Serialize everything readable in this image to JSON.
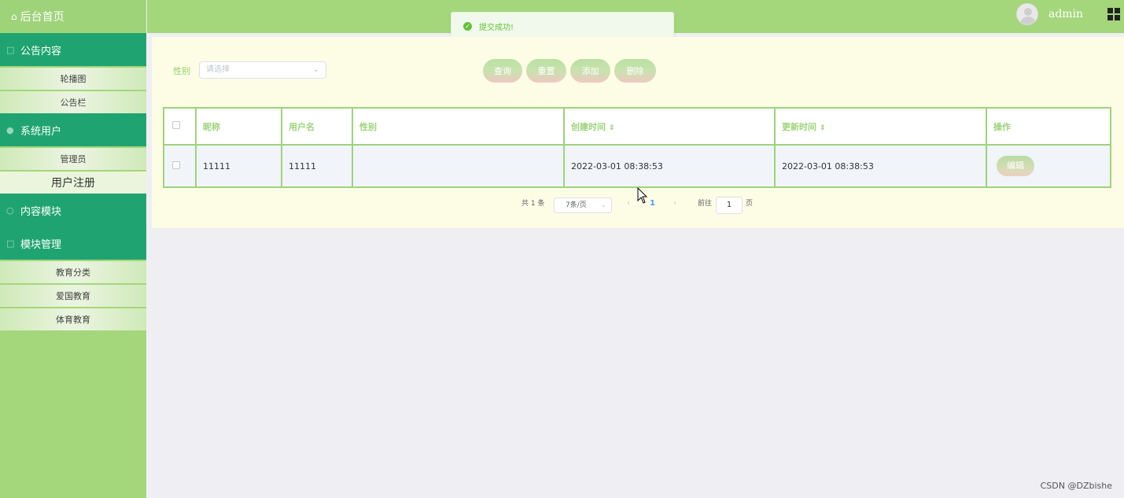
{
  "sidebar": {
    "home": "后台首页",
    "groups": [
      {
        "label": "公告内容",
        "items": [
          "轮播图",
          "公告栏"
        ]
      },
      {
        "label": "系统用户",
        "items": [
          "管理员",
          "用户注册"
        ]
      },
      {
        "label": "内容模块",
        "items": []
      },
      {
        "label": "模块管理",
        "items": [
          "教育分类",
          "爱国教育",
          "体育教育"
        ]
      }
    ]
  },
  "header": {
    "username": "admin"
  },
  "toast": {
    "message": "提交成功!"
  },
  "filter": {
    "label": "性别",
    "placeholder": "请选择"
  },
  "actions": {
    "query": "查询",
    "reset": "重置",
    "add": "添加",
    "delete": "删除"
  },
  "table": {
    "headers": [
      "昵称",
      "用户名",
      "性别",
      "创建时间",
      "更新时间",
      "操作"
    ],
    "rows": [
      {
        "nickname": "11111",
        "username": "11111",
        "gender": "",
        "created": "2022-03-01 08:38:53",
        "updated": "2022-03-01 08:38:53",
        "action": "编辑"
      }
    ]
  },
  "pagination": {
    "total": "共 1 条",
    "page_size": "7条/页",
    "current": "1",
    "goto_prefix": "前往",
    "goto_value": "1",
    "goto_suffix": "页"
  },
  "watermark": "CSDN @DZbishe",
  "colors": {
    "accent_green": "#1fa471",
    "light_green": "#a4d67c",
    "panel_bg": "#fdfde6",
    "success": "#67c23a"
  }
}
